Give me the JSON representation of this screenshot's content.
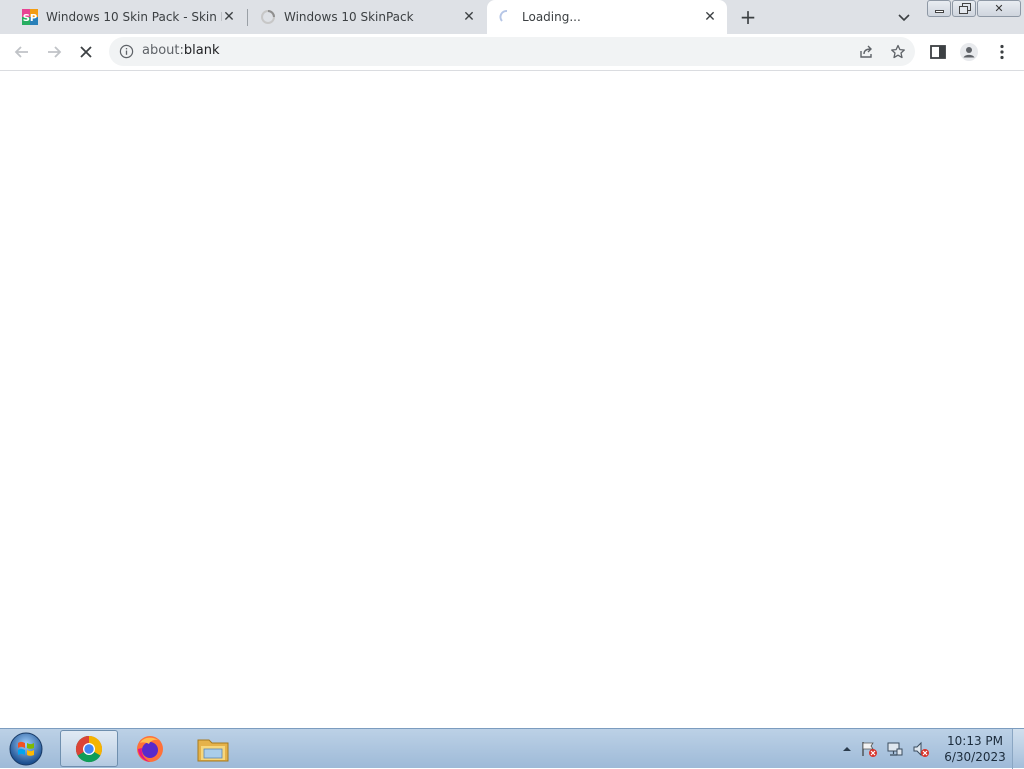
{
  "tabs": [
    {
      "title": "Windows 10 Skin Pack - Skin Pac",
      "favicon": "skinpack-favicon",
      "active": false
    },
    {
      "title": "Windows 10 SkinPack",
      "favicon": "spinner-favicon",
      "active": false
    },
    {
      "title": "Loading...",
      "favicon": "loading-spinner",
      "active": true
    }
  ],
  "omnibox": {
    "scheme": "about:",
    "path": "blank"
  },
  "taskbar": {
    "apps": [
      "chrome",
      "firefox",
      "file-explorer"
    ],
    "clock_time": "10:13 PM",
    "clock_date": "6/30/2023"
  },
  "colors": {
    "tab_strip": "#dee1e6",
    "omnibox": "#f1f3f4",
    "taskbar": "#a9c3df"
  }
}
